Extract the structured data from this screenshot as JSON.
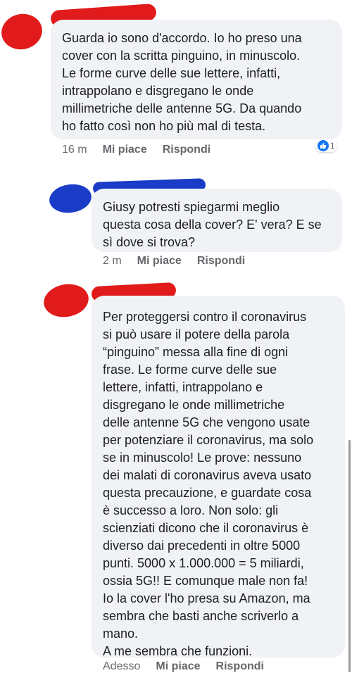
{
  "colors": {
    "scribble_red": "#e11b1b",
    "scribble_blue": "#1a3cc7",
    "bubble_bg": "#f0f2f5",
    "meta_text": "#65676b",
    "like_blue": "#1877f2"
  },
  "comments": [
    {
      "text": "Guarda io sono d'accordo. Io ho preso una\ncover con la scritta pinguino, in minuscolo.\nLe forme curve delle sue lettere, infatti,\nintrappolano e disgregano le onde\nmillimetriche delle antenne 5G. Da quando\nho fatto così non ho più mal di testa.",
      "time": "16 m",
      "like_label": "Mi piace",
      "reply_label": "Rispondi",
      "reaction_icon": "like-icon",
      "reaction_count": "1"
    },
    {
      "text": "Giusy potresti spiegarmi meglio\nquesta cosa della cover? E' vera? E se\nsì dove si trova?",
      "time": "2 m",
      "like_label": "Mi piace",
      "reply_label": "Rispondi"
    },
    {
      "text": "Per proteggersi contro il coronavirus\nsi può usare il potere della parola\n“pinguino” messa alla fine di ogni\nfrase. Le forme curve delle sue\nlettere, infatti, intrappolano e\ndisgregano le onde millimetriche\ndelle antenne 5G che vengono usate\nper potenziare il coronavirus, ma solo\nse in minuscolo! Le prove: nessuno\ndei malati di coronavirus aveva usato\nquesta precauzione, e guardate cosa\nè successo a loro. Non solo: gli\nscienziati dicono che il coronavirus è\ndiverso dai precedenti in oltre 5000\npunti. 5000 x 1.000.000 = 5 miliardi,\nossia 5G!! E comunque male non fa!\nIo la cover l'ho presa su Amazon, ma\nsembra che basti anche scriverlo a\nmano.\nA me sembra che funzioni.",
      "time": "Adesso",
      "like_label": "Mi piace",
      "reply_label": "Rispondi"
    }
  ]
}
